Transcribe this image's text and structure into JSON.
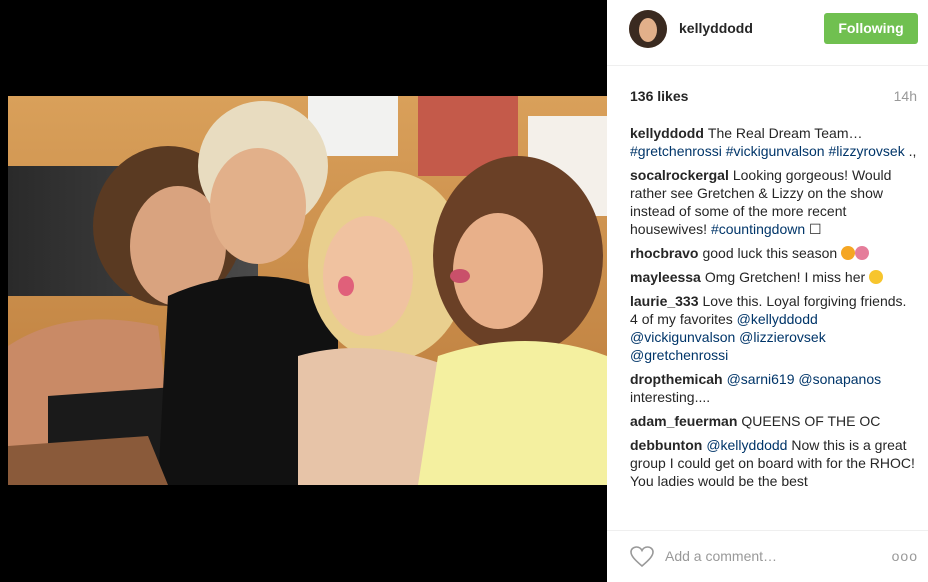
{
  "post": {
    "username": "kellyddodd",
    "follow_label": "Following",
    "likes": "136 likes",
    "time": "14h",
    "add_comment_placeholder": "Add a comment…",
    "more_label": "ooo"
  },
  "comments": [
    {
      "user": "kellyddodd",
      "text": "The Real Dream Team… #gretchenrossi #vickigunvalson #lizzyrovsek .,"
    },
    {
      "user": "socalrockergal",
      "text": "Looking gorgeous! Would rather see Gretchen & Lizzy on the show instead of some of the more recent housewives! #countingdown ☐"
    },
    {
      "user": "rhocbravo",
      "text": "good luck this season"
    },
    {
      "user": "mayleessa",
      "text": "Omg Gretchen! I miss her"
    },
    {
      "user": "laurie_333",
      "text": "Love this. Loyal forgiving friends. 4 of my favorites @kellyddodd @vickigunvalson @lizzierovsek @gretchenrossi"
    },
    {
      "user": "dropthemicah",
      "text": "@sarni619 @sonapanos interesting...."
    },
    {
      "user": "adam_feuerman",
      "text": "QUEENS OF THE OC"
    },
    {
      "user": "debbunton",
      "text": "@kellyddodd Now this is a great group I could get on board with for the RHOC! You ladies would be the best"
    }
  ],
  "colors": {
    "following_button": "#70c050",
    "link": "#003569",
    "username": "#262626",
    "muted": "#999999"
  }
}
